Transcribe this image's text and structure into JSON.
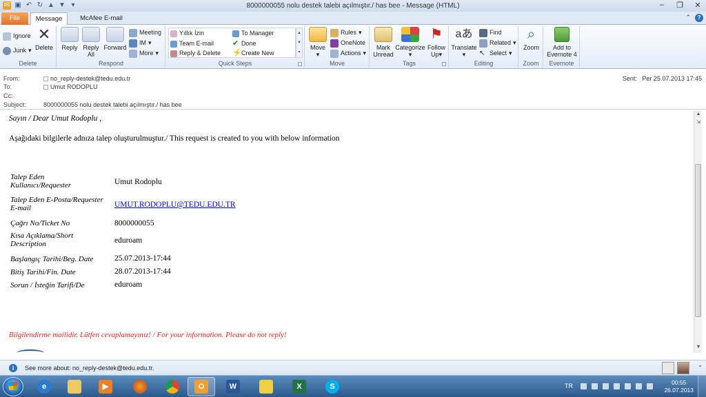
{
  "window": {
    "title": "8000000055 nolu destek talebi açılmıştır./ has bee  -  Message (HTML)",
    "help": "?"
  },
  "tabs": [
    {
      "label": "File"
    },
    {
      "label": "Message"
    },
    {
      "label": "McAfee E-mail Scan"
    }
  ],
  "ribbon": {
    "delete_group": {
      "label": "Delete",
      "ignore": "Ignore",
      "junk": "Junk",
      "delete": "Delete"
    },
    "respond_group": {
      "label": "Respond",
      "reply": "Reply",
      "reply_all": [
        "Reply",
        "All"
      ],
      "forward": "Forward",
      "meeting": "Meeting",
      "im": "IM",
      "more": "More"
    },
    "quick_steps_group": {
      "label": "Quick Steps",
      "items": [
        "Yıllık İzin",
        "To Manager",
        "Team E-mail",
        "Done",
        "Reply & Delete",
        "Create New"
      ]
    },
    "move_group": {
      "label": "Move",
      "move": "Move",
      "rules": "Rules",
      "onenote": "OneNote",
      "actions": "Actions"
    },
    "tags_group": {
      "label": "Tags",
      "mark_unread": [
        "Mark",
        "Unread"
      ],
      "categorize": "Categorize",
      "follow_up": [
        "Follow",
        "Up"
      ]
    },
    "editing_group": {
      "label": "Editing",
      "translate": "Translate",
      "find": "Find",
      "related": "Related",
      "select": "Select"
    },
    "zoom_group": {
      "label": "Zoom",
      "zoom": "Zoom"
    },
    "evernote_group": {
      "label": "Evernote",
      "add": [
        "Add to",
        "Evernote 4"
      ]
    }
  },
  "header": {
    "from_label": "From:",
    "from_value": "no_reply-destek@tedu.edu.tr",
    "to_label": "To:",
    "to_value": "Umut RODOPLU",
    "cc_label": "Cc:",
    "subject_label": "Subject:",
    "subject_value": "8000000055 nolu destek talebi açılmıştır./ has bee",
    "sent_label": "Sent:",
    "sent_value": "Per 25.07.2013 17:45"
  },
  "message": {
    "greeting": "Sayın / Dear Umut Rodoplu ,",
    "intro": "Aşağıdaki bilgilerle adnıza talep oluşturulmuştur./ This request is created to you with below information",
    "fields": [
      {
        "label": [
          "Talep Eden",
          "Kullanıcı/Requester"
        ],
        "value": "Umut Rodoplu"
      },
      {
        "label": [
          "Talep Eden E-Posta/Requester",
          "E-mail"
        ],
        "value": "UMUT.RODOPLU@TEDU.EDU.TR"
      },
      {
        "label": [
          "Çağrı No/Ticket No"
        ],
        "value": "8000000055"
      },
      {
        "label": [
          "Kısa Açıklama/Short",
          "Description"
        ],
        "value": "eduroam"
      },
      {
        "label": [
          "Başlangıç Tarihi/Beg. Date"
        ],
        "value": "25.07.2013-17:44"
      },
      {
        "label": [
          "Bitiş Tarihi/Fin. Date"
        ],
        "value": "28.07.2013-17:44"
      },
      {
        "label": [
          "Sorun / İsteğin Tarifi/De"
        ],
        "value": "eduroam"
      }
    ],
    "disclaimer": "Bilgilendirme mailidir. Lütfen cevaplamayınız! / For your information. Please do not reply!"
  },
  "people_pane": {
    "see_more": "See more about: no_reply-destek@tedu.edu.tr."
  },
  "taskbar": {
    "apps": [
      "start",
      "internet-explorer",
      "file-explorer",
      "media-player",
      "firefox",
      "chrome",
      "outlook",
      "word",
      "sticky-notes",
      "excel",
      "skype"
    ],
    "active_app": "outlook",
    "language": "TR",
    "time": "00:55",
    "date": "26.07.2013"
  },
  "colors": {
    "file_tab": "#e0752a",
    "link": "#0000ee",
    "disclaimer": "#e8231e",
    "taskbar": "#2c5a8c"
  }
}
